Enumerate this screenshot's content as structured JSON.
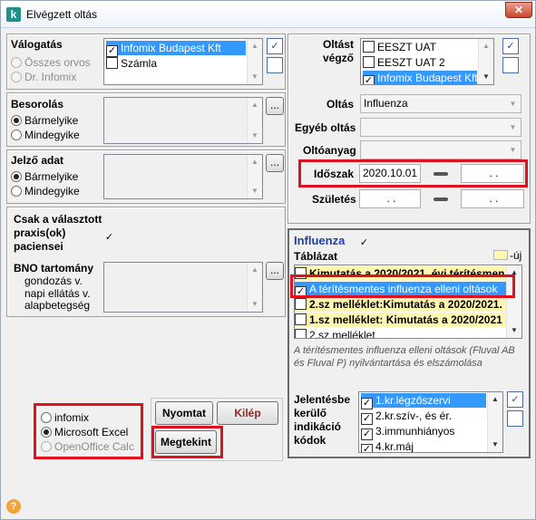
{
  "window": {
    "title": "Elvégzett oltás",
    "close_glyph": "✕",
    "app_icon": "k"
  },
  "valogatas": {
    "title": "Válogatás",
    "radios": [
      {
        "label": "Összes orvos",
        "checked": false,
        "disabled": true
      },
      {
        "label": "Dr. Infomix",
        "checked": false,
        "disabled": true
      }
    ],
    "list": [
      {
        "label": "Infomix Budapest Kft",
        "checked": true,
        "selected": true
      },
      {
        "label": "Számla",
        "checked": false,
        "selected": false
      }
    ]
  },
  "besorolas": {
    "title": "Besorolás",
    "radios": [
      {
        "label": "Bármelyike",
        "checked": true
      },
      {
        "label": "Mindegyike",
        "checked": false
      }
    ],
    "browse_label": "..."
  },
  "jelzo": {
    "title": "Jelző adat",
    "radios": [
      {
        "label": "Bármelyike",
        "checked": true
      },
      {
        "label": "Mindegyike",
        "checked": false
      }
    ],
    "browse_label": "..."
  },
  "csak": {
    "line1": "Csak a választott",
    "line2": "praxis(ok)",
    "line3": "paciensei",
    "checked": true
  },
  "bno": {
    "title": "BNO tartomány",
    "line1": "gondozás v.",
    "line2": "napi ellátás v.",
    "line3": "alapbetegség",
    "browse_label": "..."
  },
  "output": {
    "options": [
      {
        "label": "infomix",
        "checked": false,
        "disabled": false
      },
      {
        "label": "Microsoft Excel",
        "checked": true,
        "disabled": false
      },
      {
        "label": "OpenOffice Calc",
        "checked": false,
        "disabled": true
      }
    ]
  },
  "buttons": {
    "print": "Nyomtat",
    "exit": "Kilép",
    "view": "Megtekint"
  },
  "right": {
    "oltast_vegzo_line1": "Oltást",
    "oltast_vegzo_line2": "végző",
    "vegzo_list": [
      {
        "label": "EESZT UAT",
        "checked": false,
        "selected": false
      },
      {
        "label": "EESZT UAT 2",
        "checked": false,
        "selected": false
      },
      {
        "label": "Infomix Budapest Kft",
        "checked": true,
        "selected": true
      }
    ],
    "oltas_label": "Oltás",
    "oltas_value": "Influenza",
    "egyeb_label": "Egyéb oltás",
    "egyeb_value": "",
    "oltoanyag_label": "Oltóanyag",
    "oltoanyag_value": "",
    "idoszak_label": "Időszak",
    "idoszak_from": "2020.10.01",
    "idoszak_to": ". .",
    "szuletes_label": "Születés",
    "szuletes_from": ". .",
    "szuletes_to": ". ."
  },
  "influenza": {
    "title": "Influenza",
    "checked": true,
    "tablazat_label": "Táblázat",
    "new_legend": "-új",
    "tables": [
      {
        "label": "Kimutatás a 2020/2021. évi térítésmen",
        "checked": false,
        "new": true,
        "selected": false
      },
      {
        "label": "A térítésmentes influenza elleni oltások",
        "checked": true,
        "new": false,
        "selected": true
      },
      {
        "label": "2.sz melléklet:Kimutatás a 2020/2021.",
        "checked": false,
        "new": true,
        "selected": false
      },
      {
        "label": "1.sz melléklet: Kimutatás a 2020/2021",
        "checked": false,
        "new": true,
        "selected": false
      },
      {
        "label": "2.sz melléklet",
        "checked": false,
        "new": false,
        "selected": false
      }
    ],
    "description": "A térítésmentes influenza elleni oltások (Fluval AB és Fluval P) nyilvántartása és elszámolása",
    "codes_label_1": "Jelentésbe",
    "codes_label_2": "kerülő",
    "codes_label_3": "indikáció",
    "codes_label_4": "kódok",
    "codes": [
      {
        "label": "1.kr.légzőszervi",
        "checked": true,
        "selected": true
      },
      {
        "label": "2.kr.szív-, és ér.",
        "checked": true,
        "selected": false
      },
      {
        "label": "3.immunhiányos",
        "checked": true,
        "selected": false
      },
      {
        "label": "4.kr.máj",
        "checked": true,
        "selected": false
      }
    ]
  },
  "misc": {
    "help_glyph": "?",
    "check_glyph": "✓",
    "scroll_up": "▲",
    "scroll_down": "▼"
  },
  "colors": {
    "highlight": "#e0101c",
    "selection": "#3399ff",
    "new_row": "#fff6b0",
    "influenza_title": "#1f3fa8"
  }
}
